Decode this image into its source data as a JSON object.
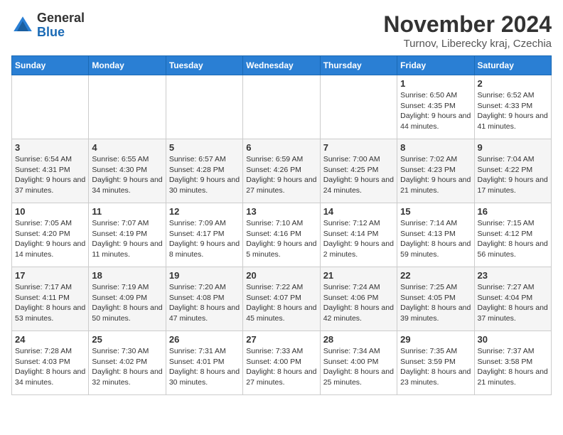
{
  "logo": {
    "general": "General",
    "blue": "Blue"
  },
  "title": "November 2024",
  "subtitle": "Turnov, Liberecky kraj, Czechia",
  "days_header": [
    "Sunday",
    "Monday",
    "Tuesday",
    "Wednesday",
    "Thursday",
    "Friday",
    "Saturday"
  ],
  "weeks": [
    [
      {
        "day": "",
        "info": ""
      },
      {
        "day": "",
        "info": ""
      },
      {
        "day": "",
        "info": ""
      },
      {
        "day": "",
        "info": ""
      },
      {
        "day": "",
        "info": ""
      },
      {
        "day": "1",
        "info": "Sunrise: 6:50 AM\nSunset: 4:35 PM\nDaylight: 9 hours and 44 minutes."
      },
      {
        "day": "2",
        "info": "Sunrise: 6:52 AM\nSunset: 4:33 PM\nDaylight: 9 hours and 41 minutes."
      }
    ],
    [
      {
        "day": "3",
        "info": "Sunrise: 6:54 AM\nSunset: 4:31 PM\nDaylight: 9 hours and 37 minutes."
      },
      {
        "day": "4",
        "info": "Sunrise: 6:55 AM\nSunset: 4:30 PM\nDaylight: 9 hours and 34 minutes."
      },
      {
        "day": "5",
        "info": "Sunrise: 6:57 AM\nSunset: 4:28 PM\nDaylight: 9 hours and 30 minutes."
      },
      {
        "day": "6",
        "info": "Sunrise: 6:59 AM\nSunset: 4:26 PM\nDaylight: 9 hours and 27 minutes."
      },
      {
        "day": "7",
        "info": "Sunrise: 7:00 AM\nSunset: 4:25 PM\nDaylight: 9 hours and 24 minutes."
      },
      {
        "day": "8",
        "info": "Sunrise: 7:02 AM\nSunset: 4:23 PM\nDaylight: 9 hours and 21 minutes."
      },
      {
        "day": "9",
        "info": "Sunrise: 7:04 AM\nSunset: 4:22 PM\nDaylight: 9 hours and 17 minutes."
      }
    ],
    [
      {
        "day": "10",
        "info": "Sunrise: 7:05 AM\nSunset: 4:20 PM\nDaylight: 9 hours and 14 minutes."
      },
      {
        "day": "11",
        "info": "Sunrise: 7:07 AM\nSunset: 4:19 PM\nDaylight: 9 hours and 11 minutes."
      },
      {
        "day": "12",
        "info": "Sunrise: 7:09 AM\nSunset: 4:17 PM\nDaylight: 9 hours and 8 minutes."
      },
      {
        "day": "13",
        "info": "Sunrise: 7:10 AM\nSunset: 4:16 PM\nDaylight: 9 hours and 5 minutes."
      },
      {
        "day": "14",
        "info": "Sunrise: 7:12 AM\nSunset: 4:14 PM\nDaylight: 9 hours and 2 minutes."
      },
      {
        "day": "15",
        "info": "Sunrise: 7:14 AM\nSunset: 4:13 PM\nDaylight: 8 hours and 59 minutes."
      },
      {
        "day": "16",
        "info": "Sunrise: 7:15 AM\nSunset: 4:12 PM\nDaylight: 8 hours and 56 minutes."
      }
    ],
    [
      {
        "day": "17",
        "info": "Sunrise: 7:17 AM\nSunset: 4:11 PM\nDaylight: 8 hours and 53 minutes."
      },
      {
        "day": "18",
        "info": "Sunrise: 7:19 AM\nSunset: 4:09 PM\nDaylight: 8 hours and 50 minutes."
      },
      {
        "day": "19",
        "info": "Sunrise: 7:20 AM\nSunset: 4:08 PM\nDaylight: 8 hours and 47 minutes."
      },
      {
        "day": "20",
        "info": "Sunrise: 7:22 AM\nSunset: 4:07 PM\nDaylight: 8 hours and 45 minutes."
      },
      {
        "day": "21",
        "info": "Sunrise: 7:24 AM\nSunset: 4:06 PM\nDaylight: 8 hours and 42 minutes."
      },
      {
        "day": "22",
        "info": "Sunrise: 7:25 AM\nSunset: 4:05 PM\nDaylight: 8 hours and 39 minutes."
      },
      {
        "day": "23",
        "info": "Sunrise: 7:27 AM\nSunset: 4:04 PM\nDaylight: 8 hours and 37 minutes."
      }
    ],
    [
      {
        "day": "24",
        "info": "Sunrise: 7:28 AM\nSunset: 4:03 PM\nDaylight: 8 hours and 34 minutes."
      },
      {
        "day": "25",
        "info": "Sunrise: 7:30 AM\nSunset: 4:02 PM\nDaylight: 8 hours and 32 minutes."
      },
      {
        "day": "26",
        "info": "Sunrise: 7:31 AM\nSunset: 4:01 PM\nDaylight: 8 hours and 30 minutes."
      },
      {
        "day": "27",
        "info": "Sunrise: 7:33 AM\nSunset: 4:00 PM\nDaylight: 8 hours and 27 minutes."
      },
      {
        "day": "28",
        "info": "Sunrise: 7:34 AM\nSunset: 4:00 PM\nDaylight: 8 hours and 25 minutes."
      },
      {
        "day": "29",
        "info": "Sunrise: 7:35 AM\nSunset: 3:59 PM\nDaylight: 8 hours and 23 minutes."
      },
      {
        "day": "30",
        "info": "Sunrise: 7:37 AM\nSunset: 3:58 PM\nDaylight: 8 hours and 21 minutes."
      }
    ]
  ]
}
